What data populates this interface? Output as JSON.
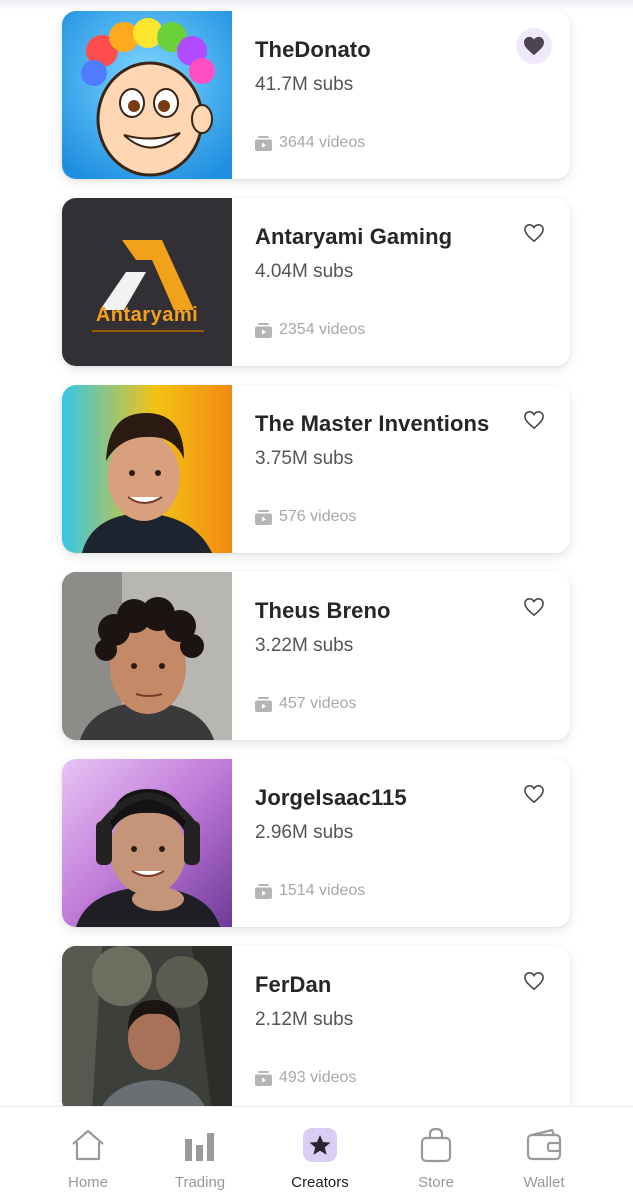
{
  "creators": [
    {
      "name": "TheDonato",
      "subs": "41.7M subs",
      "videos": "3644 videos",
      "favorited": true
    },
    {
      "name": "Antaryami Gaming",
      "subs": "4.04M subs",
      "videos": "2354 videos",
      "favorited": false,
      "logo_text": "Antaryami"
    },
    {
      "name": "The Master Inventions",
      "subs": "3.75M subs",
      "videos": "576 videos",
      "favorited": false
    },
    {
      "name": "Theus Breno",
      "subs": "3.22M subs",
      "videos": "457 videos",
      "favorited": false
    },
    {
      "name": "JorgeIsaac115",
      "subs": "2.96M subs",
      "videos": "1514 videos",
      "favorited": false
    },
    {
      "name": "FerDan",
      "subs": "2.12M subs",
      "videos": "493 videos",
      "favorited": false
    }
  ],
  "tabs": [
    {
      "label": "Home",
      "icon": "home-icon",
      "active": false
    },
    {
      "label": "Trading",
      "icon": "bar-chart-icon",
      "active": false
    },
    {
      "label": "Creators",
      "icon": "star-icon",
      "active": true
    },
    {
      "label": "Store",
      "icon": "shopping-bag-icon",
      "active": false
    },
    {
      "label": "Wallet",
      "icon": "wallet-icon",
      "active": false
    }
  ],
  "colors": {
    "accent": "#efe9fb",
    "heart_filled": "#4a4452",
    "text_muted": "#a8a8a8"
  }
}
